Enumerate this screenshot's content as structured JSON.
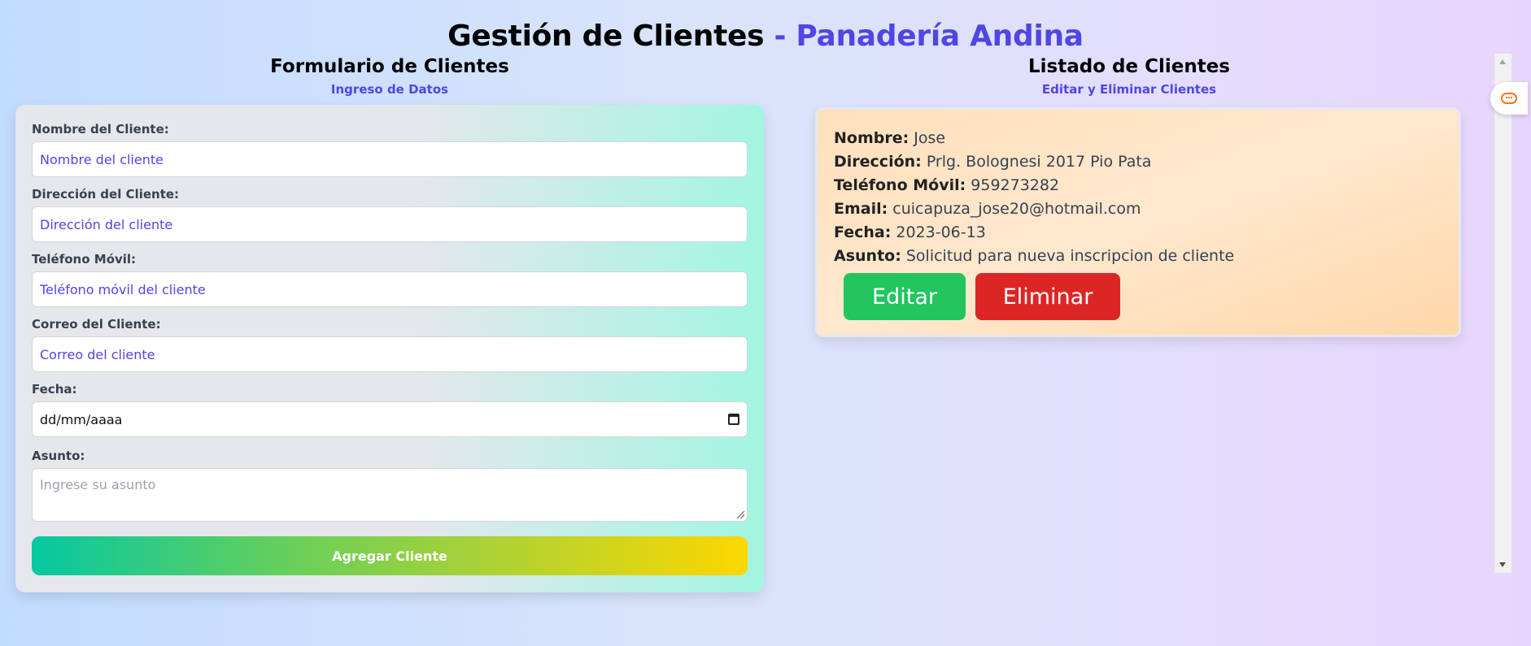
{
  "header": {
    "title_main": "Gestión de Clientes",
    "title_sep": " - ",
    "title_accent": "Panadería Andina"
  },
  "form_section": {
    "title": "Formulario de Clientes",
    "subtitle": "Ingreso de Datos",
    "fields": [
      {
        "label": "Nombre del Cliente:",
        "placeholder": "Nombre del cliente",
        "value": ""
      },
      {
        "label": "Dirección del Cliente:",
        "placeholder": "Dirección del cliente",
        "value": ""
      },
      {
        "label": "Teléfono Móvil:",
        "placeholder": "Teléfono móvil del cliente",
        "value": ""
      },
      {
        "label": "Correo del Cliente:",
        "placeholder": "Correo del cliente",
        "value": ""
      }
    ],
    "date": {
      "label": "Fecha:",
      "placeholder": "dd/mm/aaaa"
    },
    "subject": {
      "label": "Asunto:",
      "placeholder": "Ingrese su asunto"
    },
    "submit_label": "Agregar Cliente"
  },
  "list_section": {
    "title": "Listado de Clientes",
    "subtitle": "Editar y Eliminar Clientes",
    "clients": [
      {
        "rows": [
          {
            "key": "Nombre:",
            "value": "Jose"
          },
          {
            "key": "Dirección:",
            "value": "Prlg. Bolognesi 2017 Pio Pata"
          },
          {
            "key": "Teléfono Móvil:",
            "value": "959273282"
          },
          {
            "key": "Email:",
            "value": "cuicapuza_jose20@hotmail.com"
          },
          {
            "key": "Fecha:",
            "value": "2023-06-13"
          },
          {
            "key": "Asunto:",
            "value": "Solicitud para nueva inscripcion de cliente"
          }
        ],
        "edit_label": "Editar",
        "delete_label": "Eliminar"
      }
    ]
  },
  "colors": {
    "accent": "#4f46e5",
    "edit": "#22c55e",
    "delete": "#dc2626"
  },
  "icons": {
    "calendar": "calendar-icon",
    "chat": "chat-icon"
  }
}
